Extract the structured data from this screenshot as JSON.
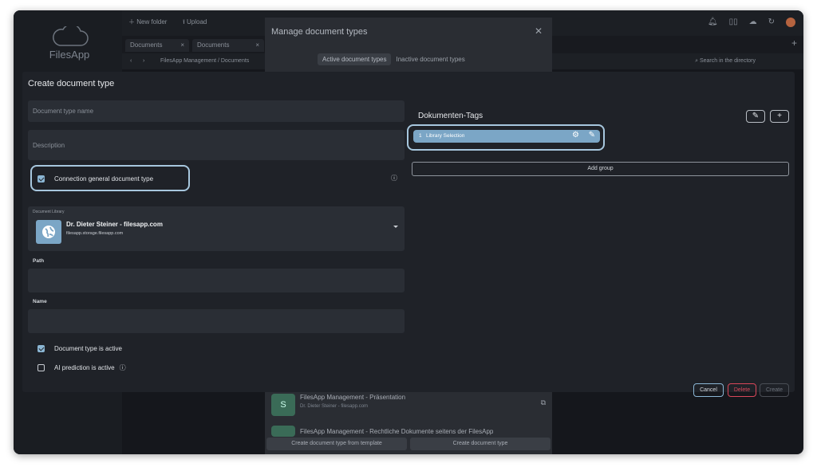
{
  "toolbar": {
    "new_folder": "New folder",
    "upload": "Upload"
  },
  "app": {
    "name": "FilesApp"
  },
  "tabs": [
    "Documents",
    "Documents"
  ],
  "breadcrumb": "FilesApp Management / Documents",
  "search": {
    "placeholder": "Search in the directory"
  },
  "manage_dialog": {
    "title": "Manage document types",
    "tab_active": "Active document types",
    "tab_inactive": "Inactive document types",
    "libraries": [
      {
        "title": "FilesApp Management - Präsentation",
        "subtitle": "Dr. Dieter Steiner - filesapp.com"
      },
      {
        "title": "FilesApp Management - Rechtliche Dokumente seitens der FilesApp",
        "subtitle": ""
      }
    ],
    "btn_from_template": "Create document type from template",
    "btn_create": "Create document type"
  },
  "create_dialog": {
    "title": "Create document type",
    "name_placeholder": "Document type name",
    "description_placeholder": "Description",
    "connection_label": "Connection general document type",
    "library_label": "Document Library",
    "library_title": "Dr. Dieter Steiner - filesapp.com",
    "library_sub": "filesapp.storage.filesapp.com",
    "path_label": "Path",
    "name_label": "Name",
    "active_label": "Document type is active",
    "ai_label": "AI prediction is active",
    "tags_title": "Dokumenten-Tags",
    "tag_number": "1",
    "tag_name": "Library Selection",
    "add_group": "Add group",
    "cancel": "Cancel",
    "delete": "Delete",
    "create": "Create"
  },
  "colors": {
    "accent": "#7ba6c6",
    "danger": "#d9475a",
    "highlight": "#a7c7de"
  }
}
